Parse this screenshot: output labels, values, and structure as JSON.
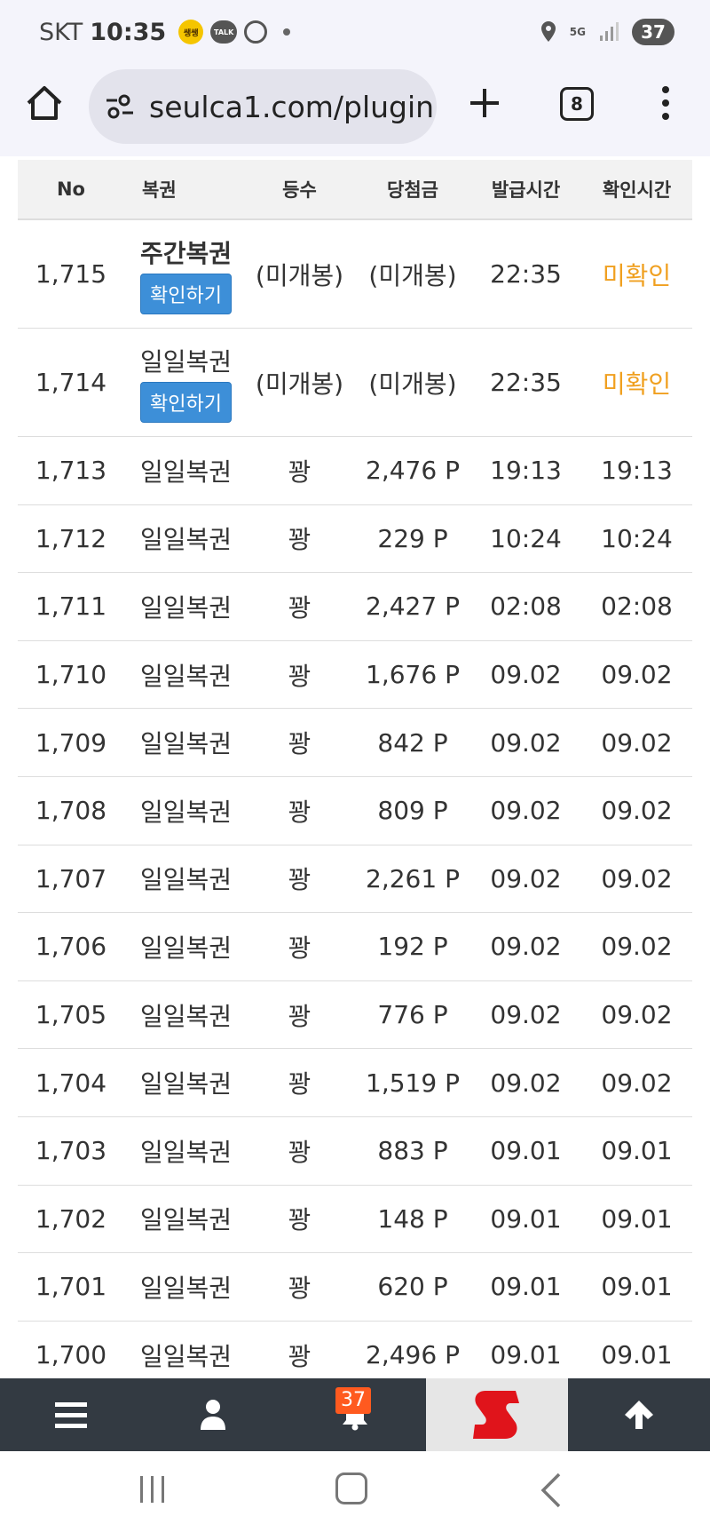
{
  "status_bar": {
    "carrier": "SKT",
    "time": "10:35",
    "network": "5G",
    "battery": "37",
    "app_icon_labels": [
      "쌩쌩",
      "TALK"
    ]
  },
  "browser": {
    "url": "seulca1.com/plugin",
    "tab_count": "8"
  },
  "table": {
    "headers": [
      "No",
      "복권",
      "등수",
      "당첨금",
      "발급시간",
      "확인시간"
    ],
    "confirm_label": "확인하기",
    "rows": [
      {
        "no": "1,715",
        "type": "주간복권",
        "grade": "(미개봉)",
        "prize": "(미개봉)",
        "issued": "22:35",
        "checked": "미확인"
      },
      {
        "no": "1,714",
        "type": "일일복권",
        "grade": "(미개봉)",
        "prize": "(미개봉)",
        "issued": "22:35",
        "checked": "미확인"
      },
      {
        "no": "1,713",
        "type": "일일복권",
        "grade": "꽝",
        "prize": "2,476 P",
        "issued": "19:13",
        "checked": "19:13"
      },
      {
        "no": "1,712",
        "type": "일일복권",
        "grade": "꽝",
        "prize": "229 P",
        "issued": "10:24",
        "checked": "10:24"
      },
      {
        "no": "1,711",
        "type": "일일복권",
        "grade": "꽝",
        "prize": "2,427 P",
        "issued": "02:08",
        "checked": "02:08"
      },
      {
        "no": "1,710",
        "type": "일일복권",
        "grade": "꽝",
        "prize": "1,676 P",
        "issued": "09.02",
        "checked": "09.02"
      },
      {
        "no": "1,709",
        "type": "일일복권",
        "grade": "꽝",
        "prize": "842 P",
        "issued": "09.02",
        "checked": "09.02"
      },
      {
        "no": "1,708",
        "type": "일일복권",
        "grade": "꽝",
        "prize": "809 P",
        "issued": "09.02",
        "checked": "09.02"
      },
      {
        "no": "1,707",
        "type": "일일복권",
        "grade": "꽝",
        "prize": "2,261 P",
        "issued": "09.02",
        "checked": "09.02"
      },
      {
        "no": "1,706",
        "type": "일일복권",
        "grade": "꽝",
        "prize": "192 P",
        "issued": "09.02",
        "checked": "09.02"
      },
      {
        "no": "1,705",
        "type": "일일복권",
        "grade": "꽝",
        "prize": "776 P",
        "issued": "09.02",
        "checked": "09.02"
      },
      {
        "no": "1,704",
        "type": "일일복권",
        "grade": "꽝",
        "prize": "1,519 P",
        "issued": "09.02",
        "checked": "09.02"
      },
      {
        "no": "1,703",
        "type": "일일복권",
        "grade": "꽝",
        "prize": "883 P",
        "issued": "09.01",
        "checked": "09.01"
      },
      {
        "no": "1,702",
        "type": "일일복권",
        "grade": "꽝",
        "prize": "148 P",
        "issued": "09.01",
        "checked": "09.01"
      },
      {
        "no": "1,701",
        "type": "일일복권",
        "grade": "꽝",
        "prize": "620 P",
        "issued": "09.01",
        "checked": "09.01"
      },
      {
        "no": "1,700",
        "type": "일일복권",
        "grade": "꽝",
        "prize": "2,496 P",
        "issued": "09.01",
        "checked": "09.01"
      }
    ]
  },
  "bottom_nav": {
    "notification_count": "37",
    "icons": [
      "menu-icon",
      "user-icon",
      "bell-icon",
      "site-logo",
      "arrow-up-icon"
    ]
  },
  "colors": {
    "confirm_button": "#3d8fd8",
    "unconfirmed_text": "#f0a020",
    "bottom_nav_bg": "#333a42",
    "badge": "#ff5a1f",
    "logo_red": "#e0141b"
  }
}
